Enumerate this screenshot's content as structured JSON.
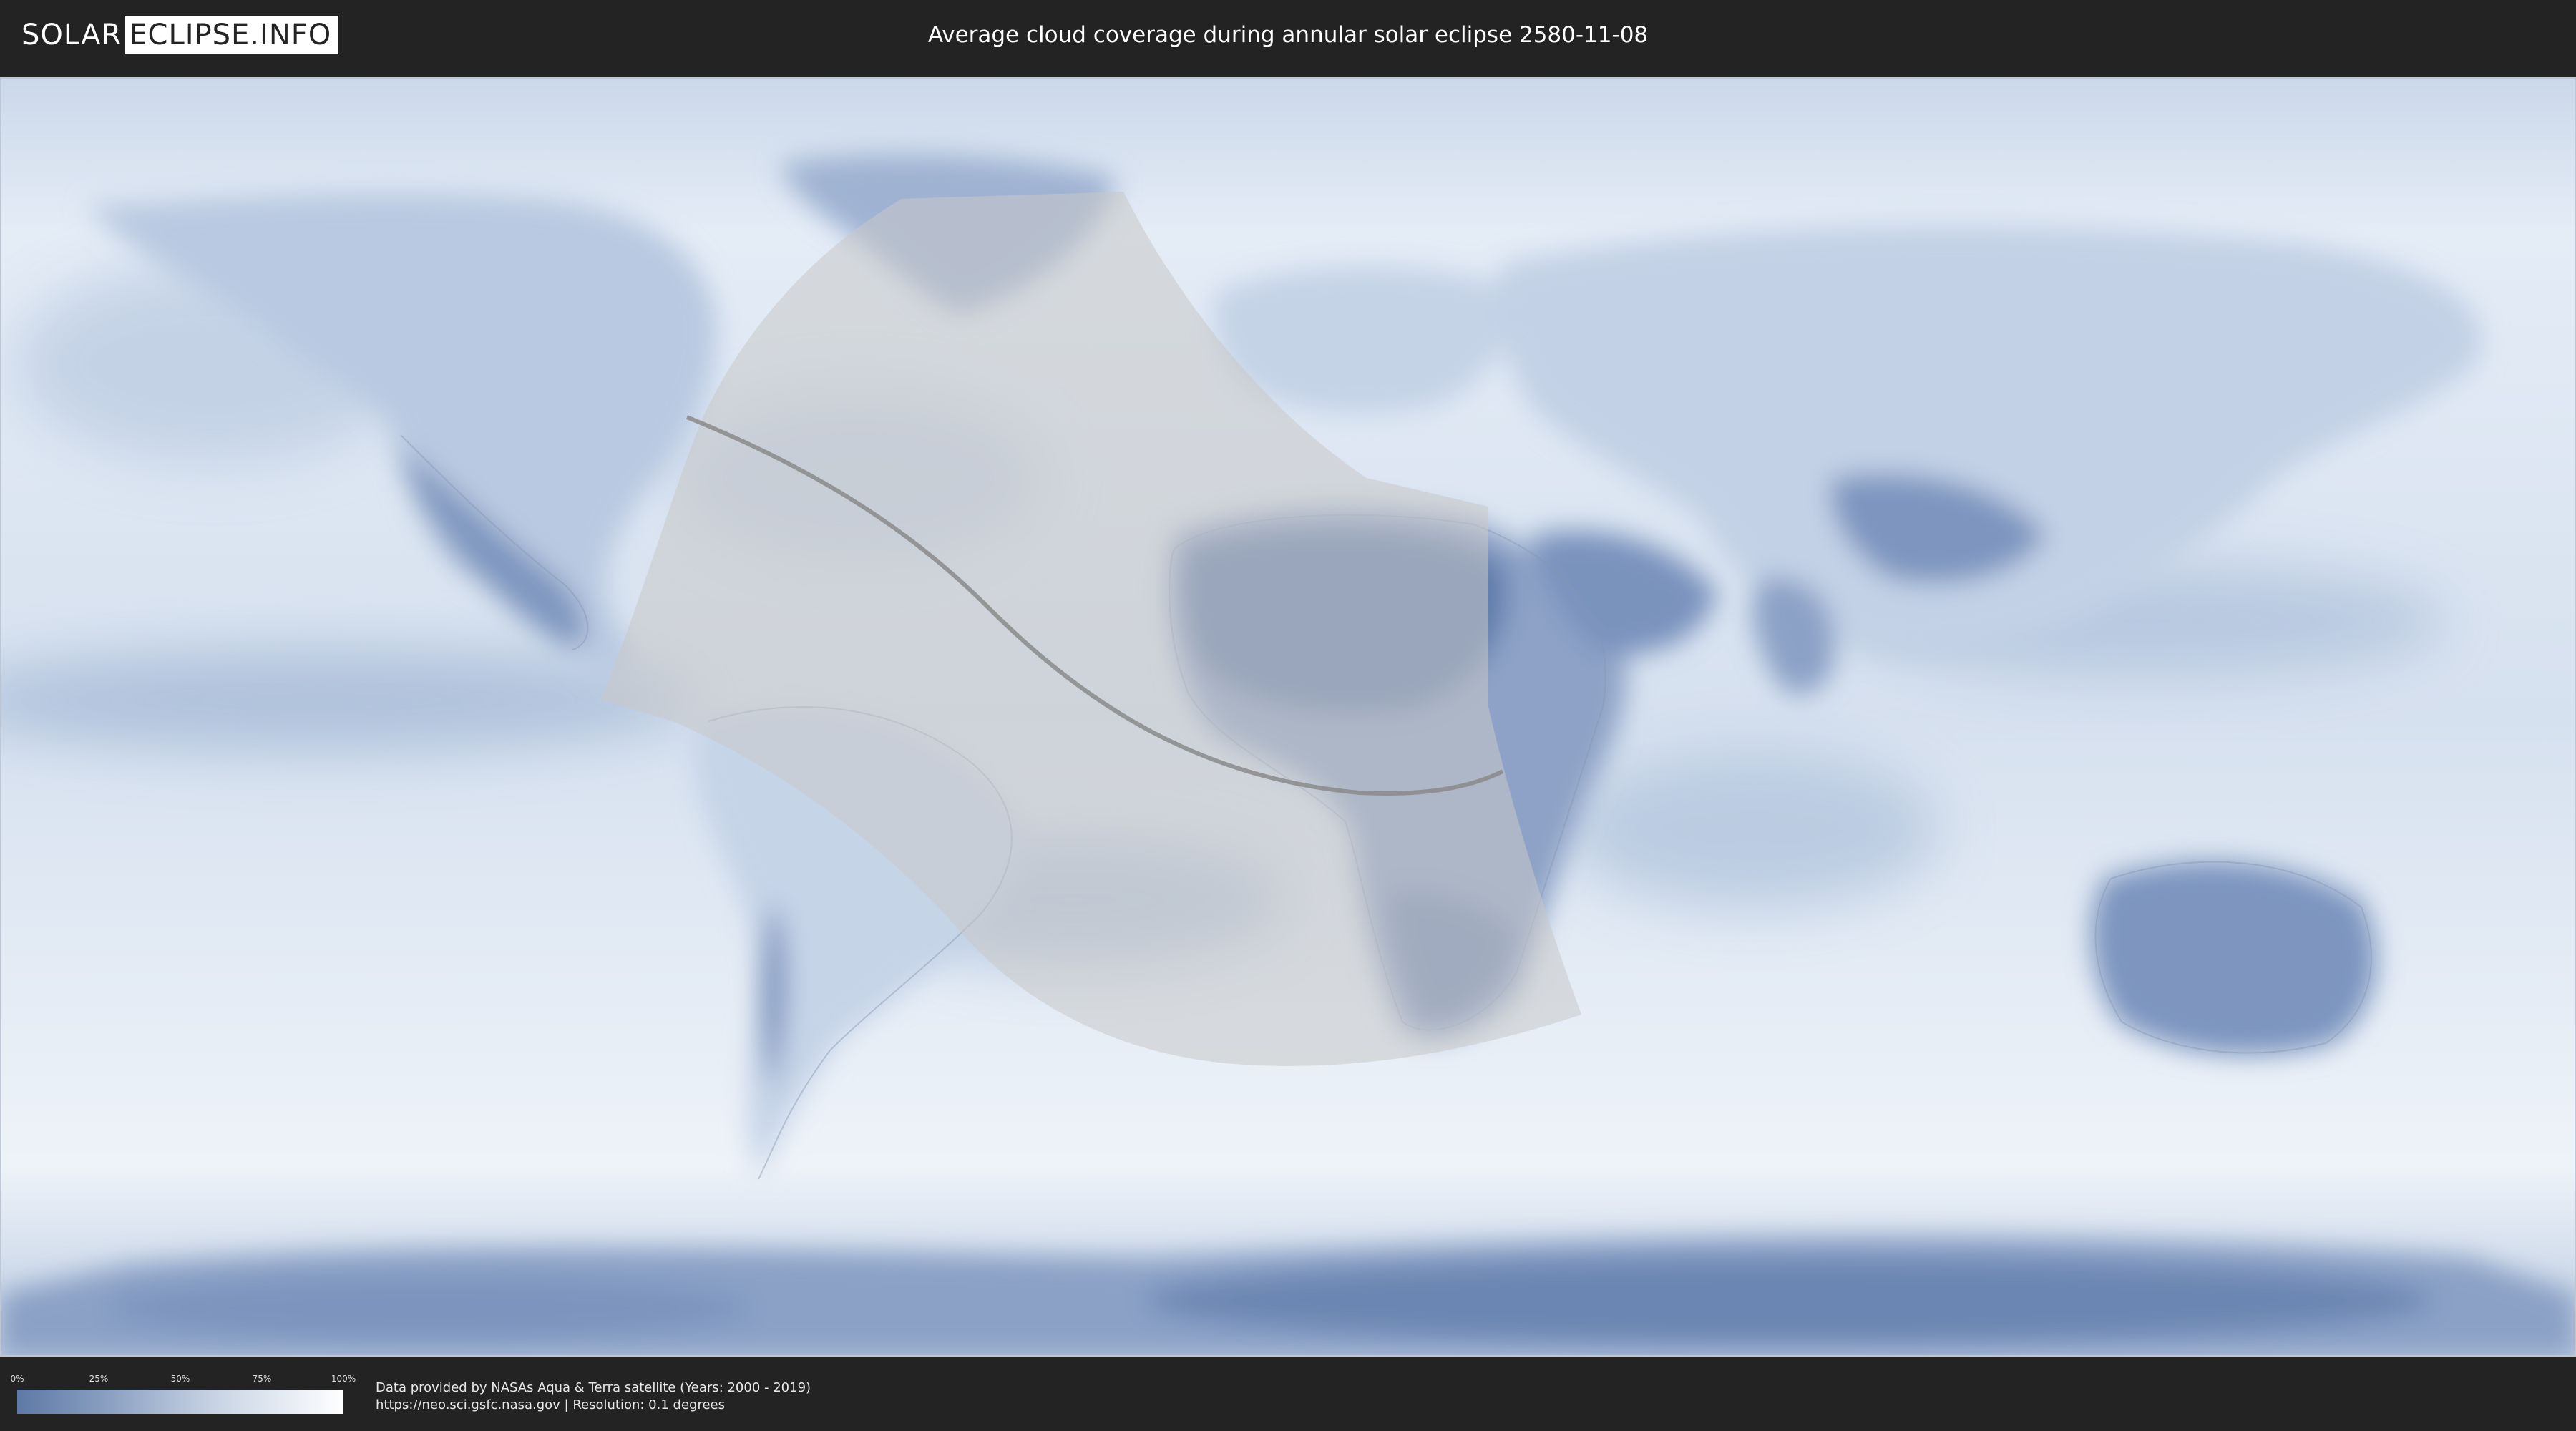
{
  "header": {
    "logo_left": "SOLAR",
    "logo_right": "ECLIPSE.INFO",
    "title": "Average cloud coverage during annular solar eclipse 2580-11-08"
  },
  "legend": {
    "ticks": [
      "0%",
      "25%",
      "50%",
      "75%",
      "100%"
    ],
    "tick_fractions": [
      0,
      0.25,
      0.5,
      0.75,
      1.0
    ],
    "color_low": "#5e79a6",
    "color_high": "#ffffff"
  },
  "credits": {
    "line1": "Data provided by NASAs Aqua & Terra satellite (Years: 2000 - 2019)",
    "line2": "https://neo.sci.gsfc.nasa.gov | Resolution: 0.1 degrees"
  },
  "map": {
    "projection": "equirectangular",
    "ocean_cloud_color": "#dfe8f3",
    "clear_land_color": "#5f7cab",
    "eclipse_shadow_color": "#c8c8c8",
    "central_line_color": "#8a8a8a"
  }
}
